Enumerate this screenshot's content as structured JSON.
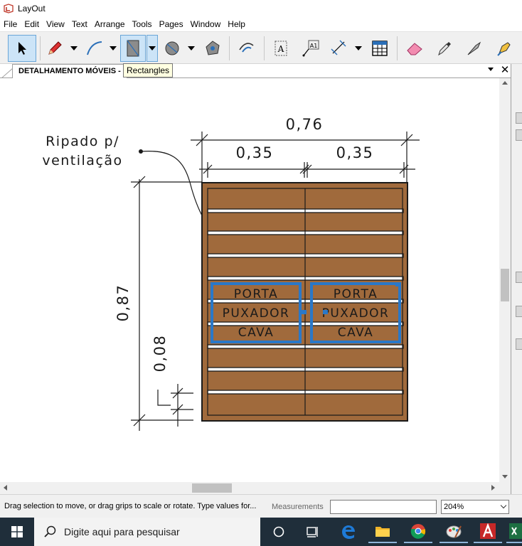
{
  "window": {
    "title": "LayOut",
    "icon": "layout-app-icon"
  },
  "menu": [
    "File",
    "Edit",
    "View",
    "Text",
    "Arrange",
    "Tools",
    "Pages",
    "Window",
    "Help"
  ],
  "toolbar": {
    "tools": [
      {
        "name": "select-tool",
        "icon": "arrow-cursor-icon"
      },
      {
        "name": "line-tool",
        "icon": "pencil-icon"
      },
      {
        "name": "arc-tool",
        "icon": "arc-icon"
      },
      {
        "name": "rectangle-tool",
        "icon": "rectangle-icon",
        "active": true
      },
      {
        "name": "circle-tool",
        "icon": "circle-icon"
      },
      {
        "name": "polygon-tool",
        "icon": "polygon-icon"
      },
      {
        "name": "offset-tool",
        "icon": "offset-icon"
      },
      {
        "name": "text-tool",
        "icon": "text-box-icon"
      },
      {
        "name": "label-tool",
        "icon": "label-icon"
      },
      {
        "name": "dimension-tool",
        "icon": "dimension-icon"
      },
      {
        "name": "table-tool",
        "icon": "table-icon"
      },
      {
        "name": "eraser-tool",
        "icon": "eraser-icon"
      },
      {
        "name": "style-tool",
        "icon": "eyedropper-icon"
      },
      {
        "name": "split-tool",
        "icon": "split-icon"
      },
      {
        "name": "join-tool",
        "icon": "join-icon"
      }
    ],
    "tooltip": "Rectangles"
  },
  "document": {
    "tab_label": "DETALHAMENTO MÓVEIS",
    "tab_suffix": " - ",
    "close_glyph": "✕"
  },
  "drawing": {
    "note_line1": "Ripado p/",
    "note_line2": "ventilação",
    "dim_total_width": "0,76",
    "dim_left_width": "0,35",
    "dim_right_width": "0,35",
    "dim_height": "0,87",
    "dim_slat": "0,08",
    "door_left": [
      "PORTA",
      "PUXADOR",
      "CAVA"
    ],
    "door_right": [
      "PORTA",
      "PUXADOR",
      "CAVA"
    ],
    "colors": {
      "wood": "#a06a3c",
      "slat_gap": "#ffffff",
      "outline": "#1a1a1a",
      "selection_blue": "#2a78c8"
    }
  },
  "status": {
    "hint": "Drag selection to move, or drag grips to scale or rotate. Type values for...",
    "measurements_label": "Measurements",
    "measurements_value": "",
    "zoom": "204%"
  },
  "taskbar": {
    "search_placeholder": "Digite aqui para pesquisar",
    "apps": [
      "task-view-icon",
      "edge-icon",
      "file-explorer-icon",
      "chrome-icon",
      "paint-icon",
      "autocad-icon",
      "excel-icon"
    ]
  }
}
